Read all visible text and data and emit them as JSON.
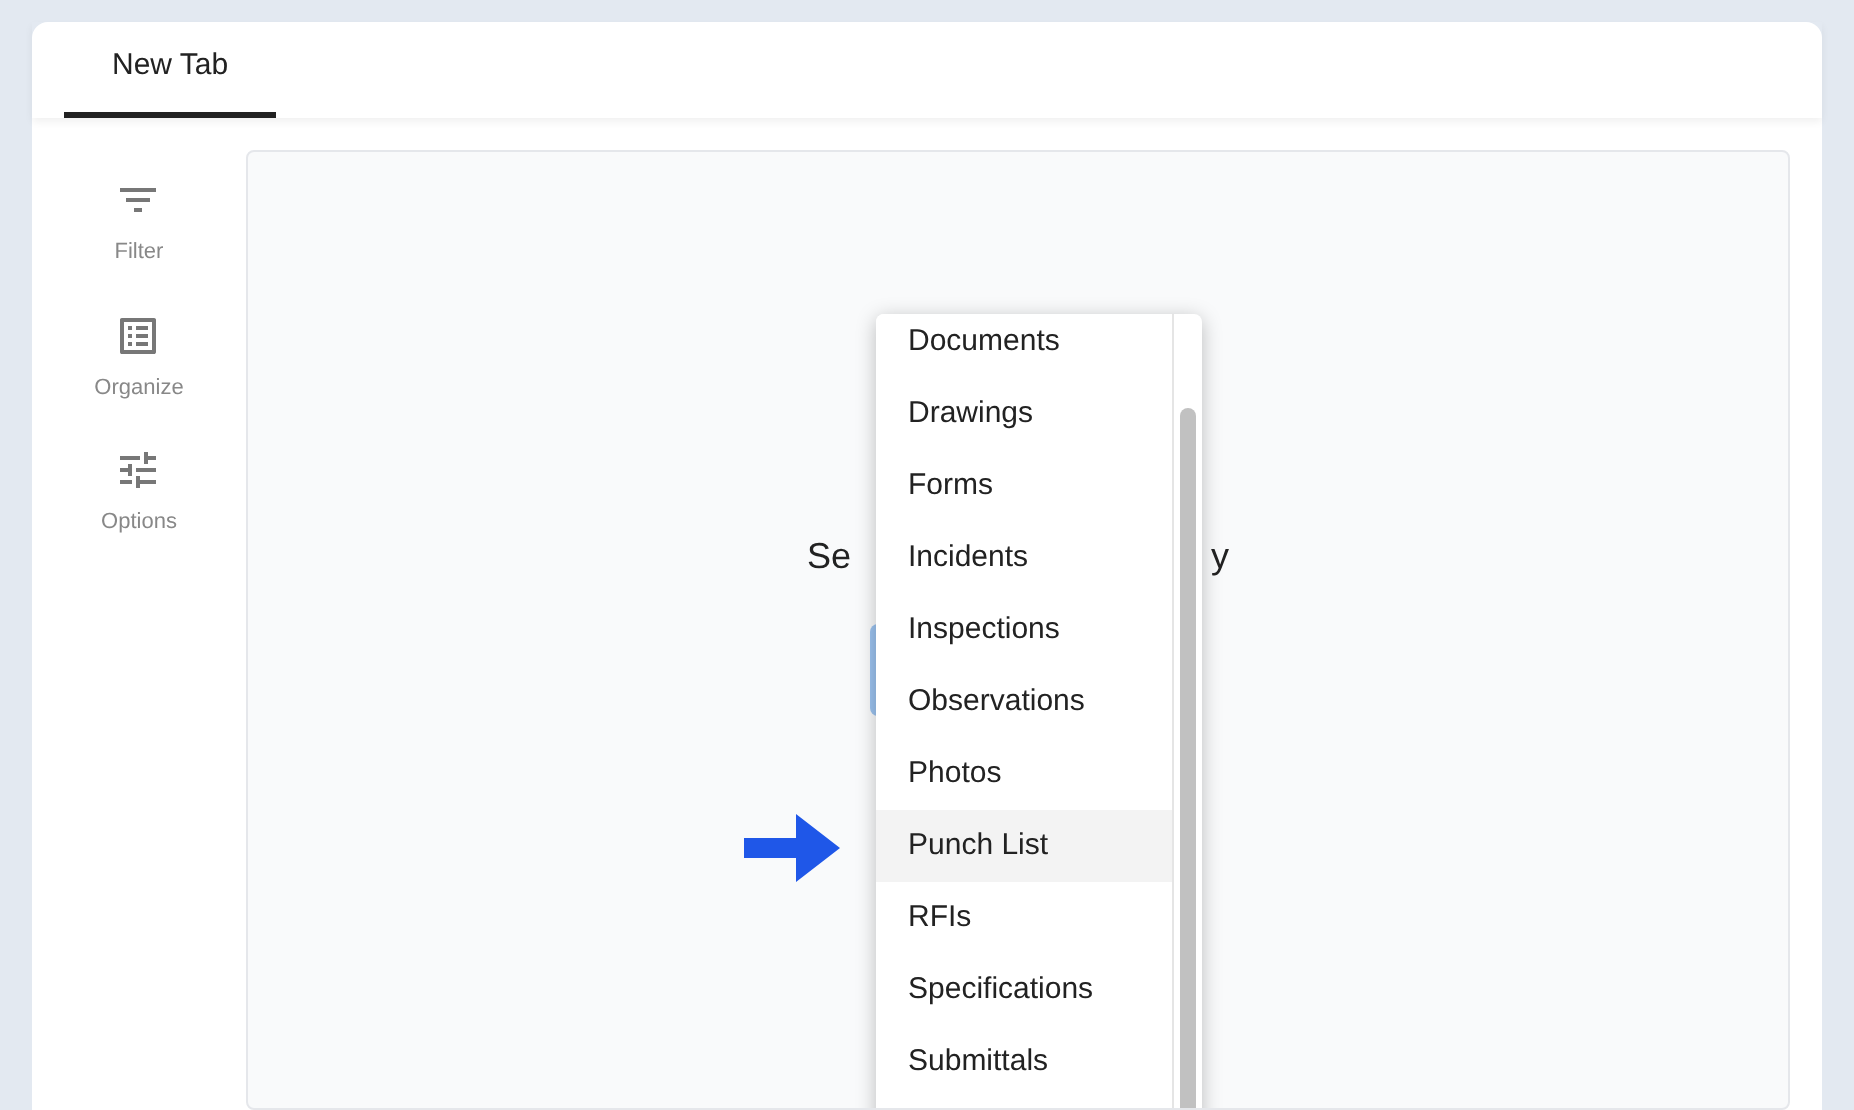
{
  "tabs": [
    {
      "label": "New Tab",
      "selected": true
    }
  ],
  "sidebar": {
    "items": [
      {
        "kind": "filter",
        "label": "Filter"
      },
      {
        "kind": "organize",
        "label": "Organize"
      },
      {
        "kind": "options",
        "label": "Options"
      }
    ]
  },
  "main": {
    "heading_parts": [
      "Se",
      "y"
    ]
  },
  "dropdown": {
    "items": [
      {
        "label": "Documents",
        "highlighted": false
      },
      {
        "label": "Drawings",
        "highlighted": false
      },
      {
        "label": "Forms",
        "highlighted": false
      },
      {
        "label": "Incidents",
        "highlighted": false
      },
      {
        "label": "Inspections",
        "highlighted": false
      },
      {
        "label": "Observations",
        "highlighted": false
      },
      {
        "label": "Photos",
        "highlighted": false
      },
      {
        "label": "Punch List",
        "highlighted": true
      },
      {
        "label": "RFIs",
        "highlighted": false
      },
      {
        "label": "Specifications",
        "highlighted": false
      },
      {
        "label": "Submittals",
        "highlighted": false
      }
    ]
  }
}
